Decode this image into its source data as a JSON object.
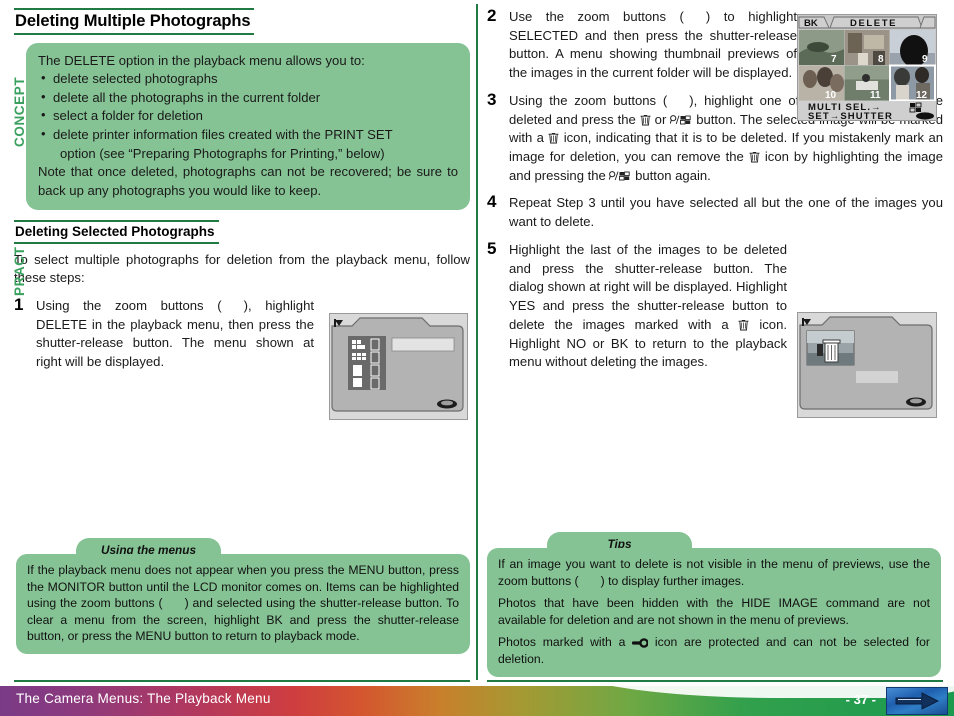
{
  "page": {
    "title": "Deleting Multiple Photographs",
    "subtitle": "Deleting Selected Photographs"
  },
  "vertical_tabs": {
    "concept": "CONCEPT",
    "practice": "PRACT"
  },
  "concept_box": {
    "intro": "The DELETE option in the playback menu allows you to:",
    "bullets": [
      "delete selected photographs",
      "delete all the photographs in the current folder",
      "select a folder for deletion",
      "delete printer information files created with the PRINT SET"
    ],
    "bullet4_cont": "option (see “Preparing Photographs for Printing,” below)",
    "note": "Note that once deleted, photographs can not be recovered; be sure to back up any photographs you would like to keep."
  },
  "intro_text": "To select multiple photographs for deletion from the playback menu, follow these steps:",
  "steps": [
    {
      "num": "1",
      "part1": "Using the zoom buttons (",
      "part2": "), highlight DELETE in the playback menu, then press the shutter-release button.  The menu shown at right will be displayed."
    },
    {
      "num": "2",
      "part1": "Use the zoom buttons (",
      "part2": ") to highlight SELECTED and then press the shutter-release button.  A menu showing thumbnail previews of the images in the current folder will be displayed."
    },
    {
      "num": "3",
      "part1": "Using the zoom buttons (",
      "part2": "), highlight one of the photographs to be deleted and press the ",
      "part3": " or ",
      "part4": " button.  The selected image will be marked with a ",
      "part5": " icon, indicating that it is to be deleted.  If you mistakenly mark an image for deletion, you can remove the ",
      "part6": " icon by highlighting the image and pressing the ",
      "part7": " button again."
    },
    {
      "num": "4",
      "part1": "Repeat Step 3 until you have selected all but the one of the images you want to delete."
    },
    {
      "num": "5",
      "part1": "Highlight the last of the images to be deleted and press the shutter-release button.  The dialog shown at right will be displayed.  Highlight YES and press the shutter-release button to delete the images marked with a ",
      "part2": " icon.  Highlight NO or BK to return to the playback menu without deleting the images."
    }
  ],
  "lcd_step2": {
    "back_label": "BK",
    "title": "DELETE",
    "thumbnail_numbers": [
      "7",
      "8",
      "9",
      "10",
      "11",
      "12"
    ],
    "footer_line1": "MULTI SEL.→",
    "footer_line2": "SET→SHUTTER"
  },
  "note_left": {
    "tab": "Using the menus",
    "part1": "If the playback menu does not appear when you press the MENU button, press the MONITOR button until the LCD monitor comes on.  Items can be highlighted using the zoom buttons (",
    "part2": ") and selected using the shutter-release button.  To clear a menu from the screen, highlight BK and press the shutter-release button, or press the MENU button to return to playback mode."
  },
  "note_right": {
    "tab": "Tips",
    "p1_part1": "If an image you want to delete is not visible in the menu of previews, use the zoom buttons (",
    "p1_part2": ") to display further images.",
    "p2": "Photos that have been hidden with the HIDE IMAGE command are not available for deletion and are not shown in the menu of previews.",
    "p3_part1": "Photos marked with a ",
    "p3_part2": " icon are protected and can not be selected for deletion."
  },
  "footer": {
    "title": "The Camera Menus: The Playback Menu",
    "page_number": "- 37 -"
  },
  "colors": {
    "green_box": "#85c394",
    "green_rule": "#1f7a44",
    "tab_green": "#3aa05e",
    "footer_purple": "#7a3b86",
    "footer_green": "#1a9a4f",
    "arrow_blue": "#1e5fae"
  }
}
